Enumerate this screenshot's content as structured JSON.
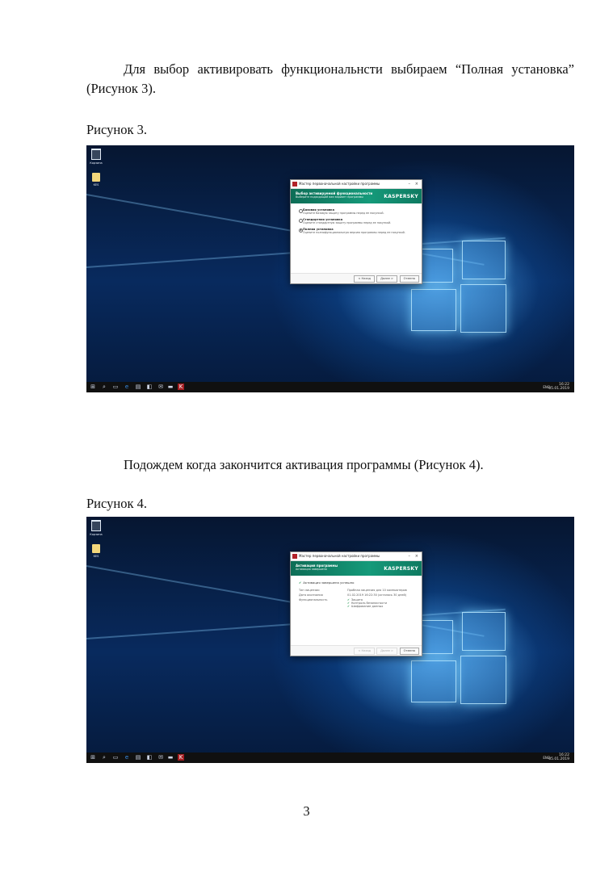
{
  "para1": "Для выбор активировать функциональнсти выбираем “Полная установка” (Рисунок 3).",
  "caption3": "Рисунок 3.",
  "para2": "Подождем когда закончится активация программы (Рисунок 4).",
  "caption4": "Рисунок 4.",
  "page_number": "3",
  "fig3": {
    "desktop_icons": [
      "Корзина",
      "KES"
    ],
    "dialog": {
      "title": "Мастер первоначальной настройки программы",
      "banner_title": "Выбор активируемой функциональности",
      "banner_sub": "Выберите подходящий вам вариант программы",
      "logo": "KASPERSKY",
      "options": [
        {
          "name": "Базовая установка",
          "desc": "Оцените базовую защиту программы перед ее покупкой.",
          "selected": false
        },
        {
          "name": "Стандартная установка",
          "desc": "Оцените стандартную защиту программы перед ее покупкой.",
          "selected": false
        },
        {
          "name": "Полная установка",
          "desc": "Оцените полнофункциональную версию программы перед ее покупкой.",
          "selected": true
        }
      ],
      "btn_back": "< Назад",
      "btn_next": "Далее >",
      "btn_cancel": "Отмена"
    },
    "tray": {
      "lang": "ENG",
      "time": "16:22",
      "date": "05.01.2019"
    }
  },
  "fig4": {
    "desktop_icons": [
      "Корзина",
      "KES"
    ],
    "dialog": {
      "title": "Мастер первоначальной настройки программы",
      "banner_title": "Активация программы",
      "banner_sub": "Активация завершена",
      "logo": "KASPERSKY",
      "status": "Активация завершена успешно",
      "rows": [
        {
          "key": "Тип лицензии",
          "value": "Пробная лицензия для 10 компьютеров"
        },
        {
          "key": "Дата окончания",
          "value": "01.02.2019 16:22:30 (осталось 30 дней)"
        }
      ],
      "func_label": "Функциональность",
      "features": [
        "Защита",
        "Контроль безопасности",
        "Шифрование данных"
      ],
      "btn_back": "< Назад",
      "btn_next": "Далее >",
      "btn_cancel": "Отмена"
    },
    "tray": {
      "lang": "ENG",
      "time": "16:22",
      "date": "05.01.2019"
    }
  }
}
